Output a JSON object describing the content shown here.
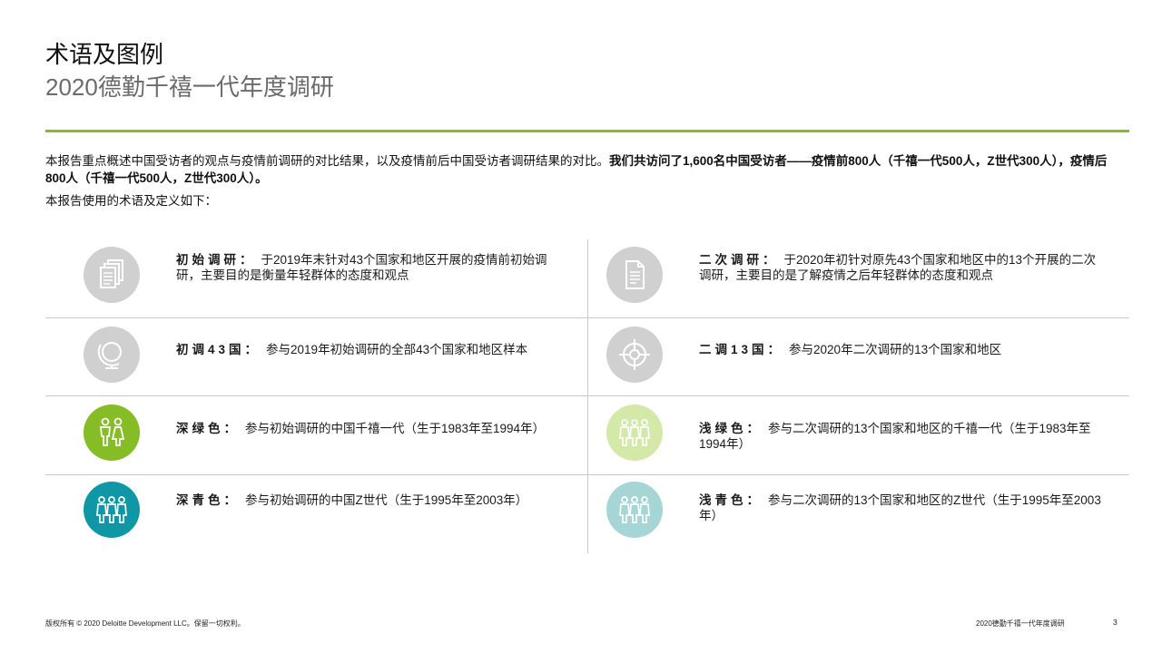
{
  "header": {
    "title": "术语及图例",
    "subtitle": "2020德勤千禧一代年度调研"
  },
  "intro": {
    "text_normal": "本报告重点概述中国受访者的观点与疫情前调研的对比结果，以及疫情前后中国受访者调研结果的对比。",
    "text_bold": "我们共访问了1,600名中国受访者——疫情前800人（千禧一代500人，Z世代300人），疫情后800人（千禧一代500人，Z世代300人）。",
    "definitions_line": "本报告使用的术语及定义如下："
  },
  "legend": [
    {
      "term": "初始调研：",
      "desc": "于2019年末针对43个国家和地区开展的疫情前初始调研，主要目的是衡量年轻群体的态度和观点",
      "icon": "documents-stack-icon",
      "color": "#d0d0d0"
    },
    {
      "term": "二次调研：",
      "desc": "于2020年初针对原先43个国家和地区中的13个开展的二次调研，主要目的是了解疫情之后年轻群体的态度和观点",
      "icon": "document-icon",
      "color": "#d0d0d0"
    },
    {
      "term": "初调43国：",
      "desc": "参与2019年初始调研的全部43个国家和地区样本",
      "icon": "globe-icon",
      "color": "#d0d0d0"
    },
    {
      "term": "二调13国：",
      "desc": "参与2020年二次调研的13个国家和地区",
      "icon": "target-icon",
      "color": "#d0d0d0"
    },
    {
      "term": "深绿色：",
      "desc": "参与初始调研的中国千禧一代（生于1983年至1994年）",
      "icon": "people-two-icon",
      "color": "#86bc25"
    },
    {
      "term": "浅绿色：",
      "desc": "参与二次调研的13个国家和地区的千禧一代（生于1983年至1994年）",
      "icon": "people-three-icon",
      "color": "#d4e8a8"
    },
    {
      "term": "深青色：",
      "desc": "参与初始调研的中国Z世代（生于1995年至2003年）",
      "icon": "people-three-icon",
      "color": "#0f97a6"
    },
    {
      "term": "浅青色：",
      "desc": "参与二次调研的13个国家和地区的Z世代（生于1995年至2003年）",
      "icon": "people-three-icon",
      "color": "#a5d5d5"
    }
  ],
  "footer": {
    "copyright": "版权所有 © 2020 Deloitte Development LLC。保留一切权利。",
    "report_name": "2020德勤千禧一代年度调研",
    "page_number": "3"
  }
}
